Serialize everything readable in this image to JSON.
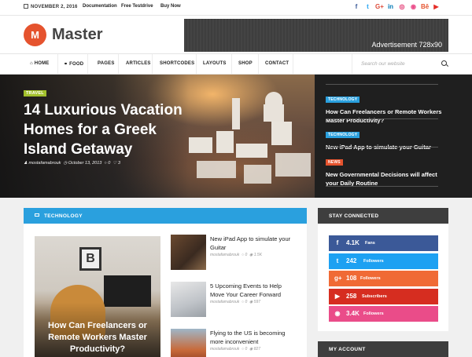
{
  "topbar": {
    "date": "NOVEMBER 2, 2016",
    "links": [
      "Documentation",
      "Free Testdrive",
      "Buy Now"
    ],
    "social": [
      {
        "icon": "facebook-icon",
        "glyph": "f",
        "color": "#3b5998"
      },
      {
        "icon": "twitter-icon",
        "glyph": "t",
        "color": "#1da1f2"
      },
      {
        "icon": "google-plus-icon",
        "glyph": "G+",
        "color": "#dd4b39"
      },
      {
        "icon": "linkedin-icon",
        "glyph": "in",
        "color": "#0077b5"
      },
      {
        "icon": "instagram-icon",
        "glyph": "◎",
        "color": "#e1306c"
      },
      {
        "icon": "dribbble-icon",
        "glyph": "◉",
        "color": "#ea4c89"
      },
      {
        "icon": "behance-icon",
        "glyph": "Bē",
        "color": "#e5532e"
      },
      {
        "icon": "youtube-icon",
        "glyph": "▶",
        "color": "#e52d27"
      }
    ]
  },
  "header": {
    "logo_letter": "M",
    "logo_text": "Master",
    "ad_text": "Advertisement 728x90"
  },
  "nav": {
    "items": [
      {
        "label": "HOME",
        "icon": "home-icon"
      },
      {
        "label": "FOOD",
        "icon": "food-icon"
      },
      {
        "label": "PAGES"
      },
      {
        "label": "ARTICLES"
      },
      {
        "label": "SHORTCODES"
      },
      {
        "label": "LAYOUTS"
      },
      {
        "label": "SHOP"
      },
      {
        "label": "CONTACT"
      }
    ],
    "search_placeholder": "Search our website"
  },
  "hero": {
    "tag": "TRAVEL",
    "title": "14 Luxurious Vacation Homes for a Greek Island Getaway",
    "author": "mostafamabrouk",
    "date": "October 13, 2013",
    "comments": "0",
    "likes": "3",
    "side_items": [
      {
        "tag": "TECHNOLOGY",
        "tag_color": "#2aa0de",
        "title": "How Can Freelancers or Remote Workers Master Productivity?"
      },
      {
        "tag": "TECHNOLOGY",
        "tag_color": "#2aa0de",
        "title": "New iPad App to simulate your Guitar"
      },
      {
        "tag": "NEWS",
        "tag_color": "#e5532e",
        "title": "New Governmental Decisions will affect your Daily Routine"
      }
    ]
  },
  "main": {
    "section_title": "TECHNOLOGY",
    "feature_title": "How Can Freelancers or Remote Workers Master Productivity?",
    "feature_frame_letter": "B",
    "posts": [
      {
        "title": "New iPad App to simulate your Guitar",
        "author": "mostafamabrouk",
        "comments": "0",
        "views": "1.5K"
      },
      {
        "title": "5 Upcoming Events to Help Move Your Career Forward",
        "author": "mostafamabrouk",
        "comments": "0",
        "views": "597"
      },
      {
        "title": "Flying to the US is becoming more inconvenient",
        "author": "mostafamabrouk",
        "comments": "0",
        "views": "827"
      }
    ]
  },
  "sidebar": {
    "stay_connected_title": "STAY CONNECTED",
    "counters": [
      {
        "icon": "facebook-icon",
        "glyph": "f",
        "count": "4.1K",
        "label": "Fans",
        "color": "#3b5998"
      },
      {
        "icon": "twitter-icon",
        "glyph": "t",
        "count": "242",
        "label": "Followers",
        "color": "#1da1f2"
      },
      {
        "icon": "google-plus-icon",
        "glyph": "g+",
        "count": "108",
        "label": "Followers",
        "color": "#f06a35"
      },
      {
        "icon": "youtube-icon",
        "glyph": "▶",
        "count": "258",
        "label": "Subscribers",
        "color": "#d62d20"
      },
      {
        "icon": "dribbble-icon",
        "glyph": "◉",
        "count": "3.4K",
        "label": "Followers",
        "color": "#ea4c89"
      }
    ],
    "account_title": "MY ACCOUNT"
  }
}
